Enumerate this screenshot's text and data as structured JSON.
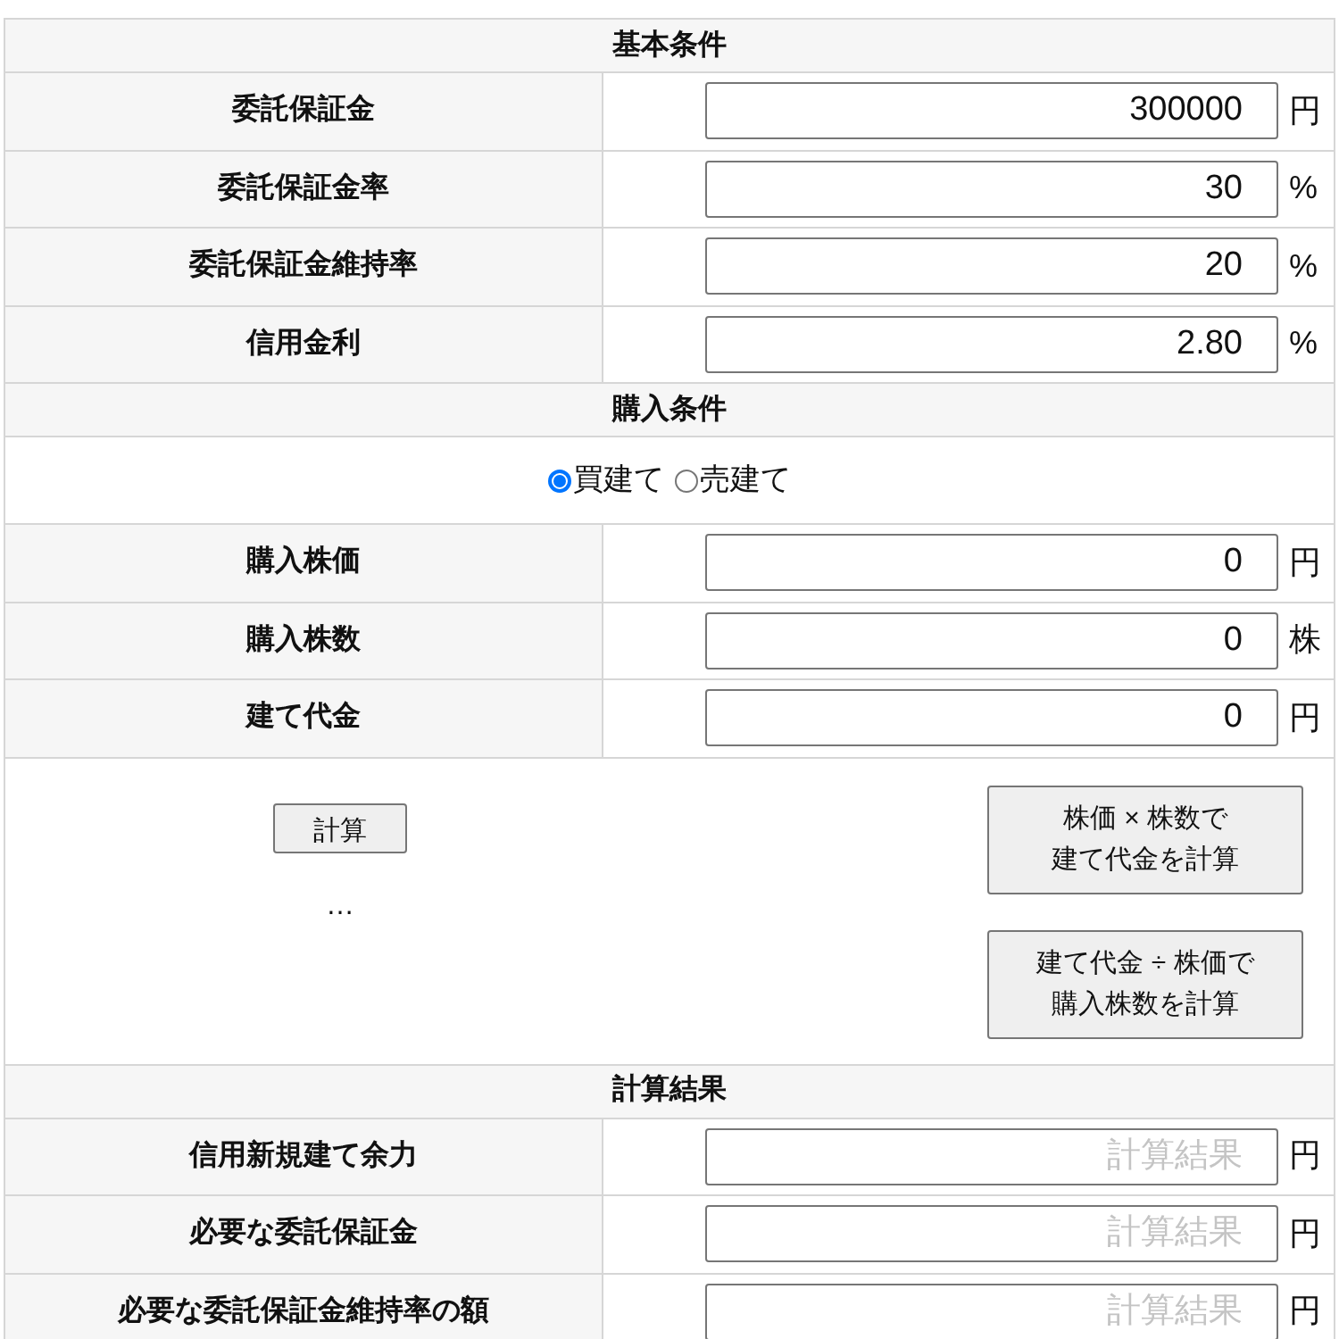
{
  "basic": {
    "title": "基本条件",
    "rows": [
      {
        "label": "委託保証金",
        "value": "300000",
        "unit": "円"
      },
      {
        "label": "委託保証金率",
        "value": "30",
        "unit": "%"
      },
      {
        "label": "委託保証金維持率",
        "value": "20",
        "unit": "%"
      },
      {
        "label": "信用金利",
        "value": "2.80",
        "unit": "%"
      }
    ]
  },
  "purchase": {
    "title": "購入条件",
    "options": [
      {
        "label": "買建て",
        "selected": true
      },
      {
        "label": "売建て",
        "selected": false
      }
    ],
    "rows": [
      {
        "label": "購入株価",
        "value": "0",
        "unit": "円"
      },
      {
        "label": "購入株数",
        "value": "0",
        "unit": "株"
      },
      {
        "label": "建て代金",
        "value": "0",
        "unit": "円"
      }
    ]
  },
  "actions": {
    "calc_button": "計算",
    "status": "…",
    "buttons": [
      {
        "lines": [
          "株価 × 株数で",
          "建て代金を計算"
        ]
      },
      {
        "lines": [
          "建て代金 ÷ 株価で",
          "購入株数を計算"
        ]
      }
    ]
  },
  "results": {
    "title": "計算結果",
    "rows": [
      {
        "label": "信用新規建て余力",
        "placeholder": "計算結果",
        "unit": "円"
      },
      {
        "label": "必要な委託保証金",
        "placeholder": "計算結果",
        "unit": "円"
      },
      {
        "label": "必要な委託保証金維持率の額",
        "placeholder": "計算結果",
        "unit": "円"
      }
    ]
  }
}
